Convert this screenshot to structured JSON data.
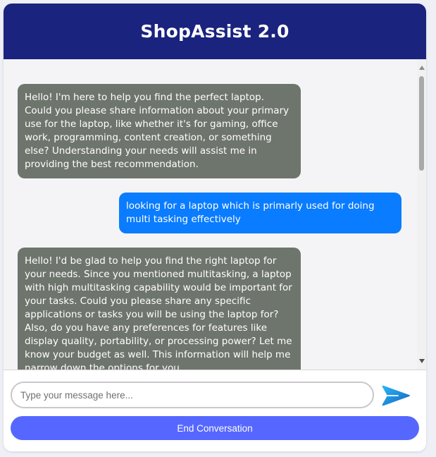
{
  "header": {
    "title": "ShopAssist 2.0"
  },
  "messages": [
    {
      "role": "assistant",
      "text": "Hello! I'm here to help you find the perfect laptop. Could you please share information about your primary use for the laptop, like whether it's for gaming, office work, programming, content creation, or something else? Understanding your needs will assist me in providing the best recommendation."
    },
    {
      "role": "user",
      "text": "looking for a laptop which is primarly used for doing multi tasking effectively"
    },
    {
      "role": "assistant",
      "text": "Hello! I'd be glad to help you find the right laptop for your needs. Since you mentioned multitasking, a laptop with high multitasking capability would be important for your tasks. Could you please share any specific applications or tasks you will be using the laptop for? Also, do you have any preferences for features like display quality, portability, or processing power? Let me know your budget as well. This information will help me narrow down the options for you."
    }
  ],
  "composer": {
    "placeholder": "Type your message here...",
    "value": "",
    "send_icon": "send-arrow-icon",
    "end_label": "End Conversation"
  },
  "colors": {
    "header_bg": "#1a237e",
    "assistant_bubble": "#6e756c",
    "user_bubble": "#0a7cff",
    "end_button": "#5667ff",
    "send_icon": "#1e88e5"
  }
}
